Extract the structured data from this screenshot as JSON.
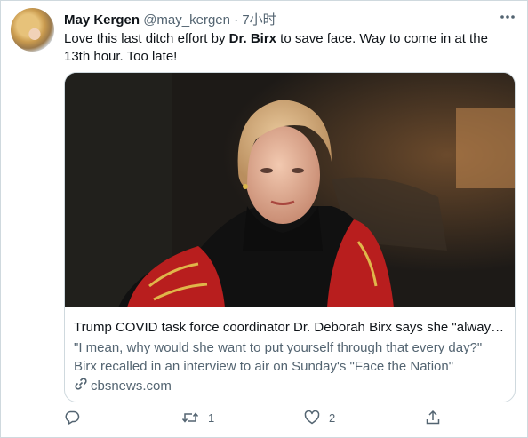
{
  "tweet": {
    "author_name": "May Kergen",
    "author_handle": "@may_kergen",
    "separator": "·",
    "timestamp": "7小时",
    "text_before": "Love this last ditch effort by ",
    "text_bold": "Dr. Birx",
    "text_after": " to save face. Way to come in at the 13th hour. Too late!"
  },
  "card": {
    "title": "Trump COVID task force coordinator Dr. Deborah Birx says she \"always\" ...",
    "description": "\"I mean, why would she want to put yourself through that every day?\" Birx recalled in an interview to air on Sunday's \"Face the Nation\"",
    "domain": "cbsnews.com"
  },
  "actions": {
    "reply_count": "",
    "retweet_count": "1",
    "like_count": "2"
  },
  "icons": {
    "more": "more-icon",
    "reply": "reply-icon",
    "retweet": "retweet-icon",
    "like": "like-icon",
    "share": "share-icon",
    "link": "link-icon"
  },
  "colors": {
    "text": "#0f1419",
    "secondary": "#536471",
    "border": "#cfd9de"
  }
}
